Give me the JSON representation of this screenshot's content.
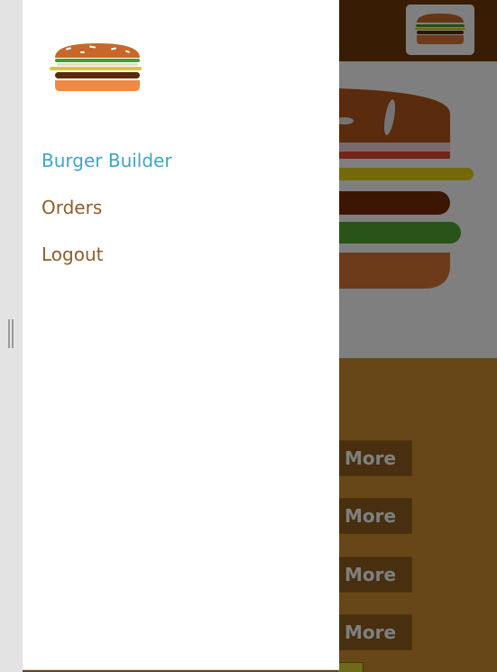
{
  "drawer": {
    "nav": [
      {
        "label": "Burger Builder",
        "active": true
      },
      {
        "label": "Orders",
        "active": false
      },
      {
        "label": "Logout",
        "active": false
      }
    ]
  },
  "controls": {
    "more_buttons": [
      "More",
      "More",
      "More",
      "More"
    ]
  },
  "colors": {
    "toolbar": "#703b09",
    "active_link": "#40a4c8",
    "link": "#8f5c2c",
    "controls_bg": "#cf8f2e",
    "more_button": "#8f5e1e"
  }
}
